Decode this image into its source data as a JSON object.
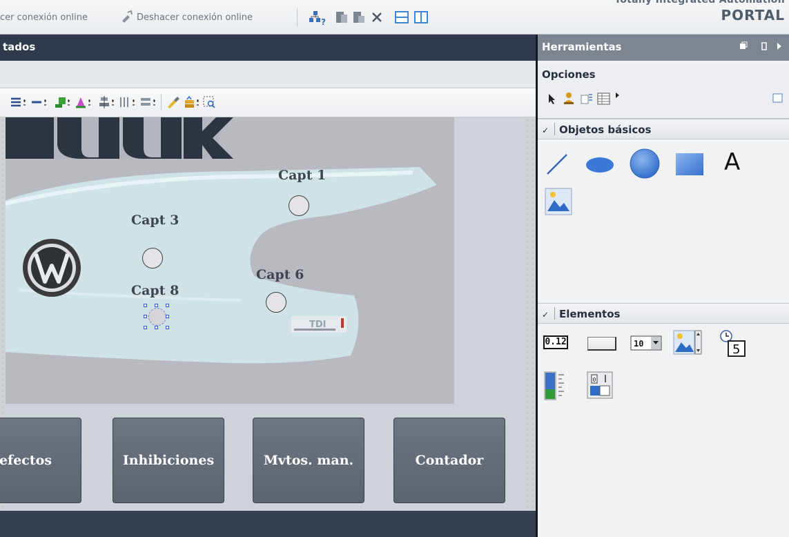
{
  "toolbar": {
    "go_online_label": "cer conexión online",
    "go_offline_label": "Deshacer conexión online"
  },
  "portal": {
    "line1": "Totally Integrated Automation",
    "line2": "PORTAL"
  },
  "editor": {
    "title": "tados"
  },
  "screen": {
    "sensors": [
      {
        "label": "Capt 1"
      },
      {
        "label": "Capt 3"
      },
      {
        "label": "Capt 6"
      },
      {
        "label": "Capt 8"
      }
    ],
    "buttons": [
      {
        "label": "efectos"
      },
      {
        "label": "Inhibiciones"
      },
      {
        "label": "Mvtos. man."
      },
      {
        "label": "Contador"
      }
    ],
    "logo_text": "TDI",
    "top_logo_text": "TUUK"
  },
  "tools": {
    "title": "Herramientas",
    "options_title": "Opciones",
    "basic_objects_title": "Objetos básicos",
    "basic_objects": [
      "line-tool-icon",
      "ellipse-tool-icon",
      "circle-tool-icon",
      "rectangle-tool-icon",
      "text-tool-icon",
      "graphic-view-tool-icon"
    ],
    "text_tool_glyph": "A",
    "elements_title": "Elementos",
    "elements": [
      "io-field-icon",
      "button-element-icon",
      "symbolic-io-field-icon",
      "graphic-io-field-icon",
      "date-time-field-icon",
      "bar-element-icon",
      "switch-element-icon"
    ],
    "io_field_glyph": "0.12",
    "symbolic_glyph": "10",
    "clock_glyph": "5"
  },
  "colors": {
    "accent_dark": "#2f3b4c",
    "hmi_button": "#636b77",
    "tools_header": "#7d8591"
  }
}
